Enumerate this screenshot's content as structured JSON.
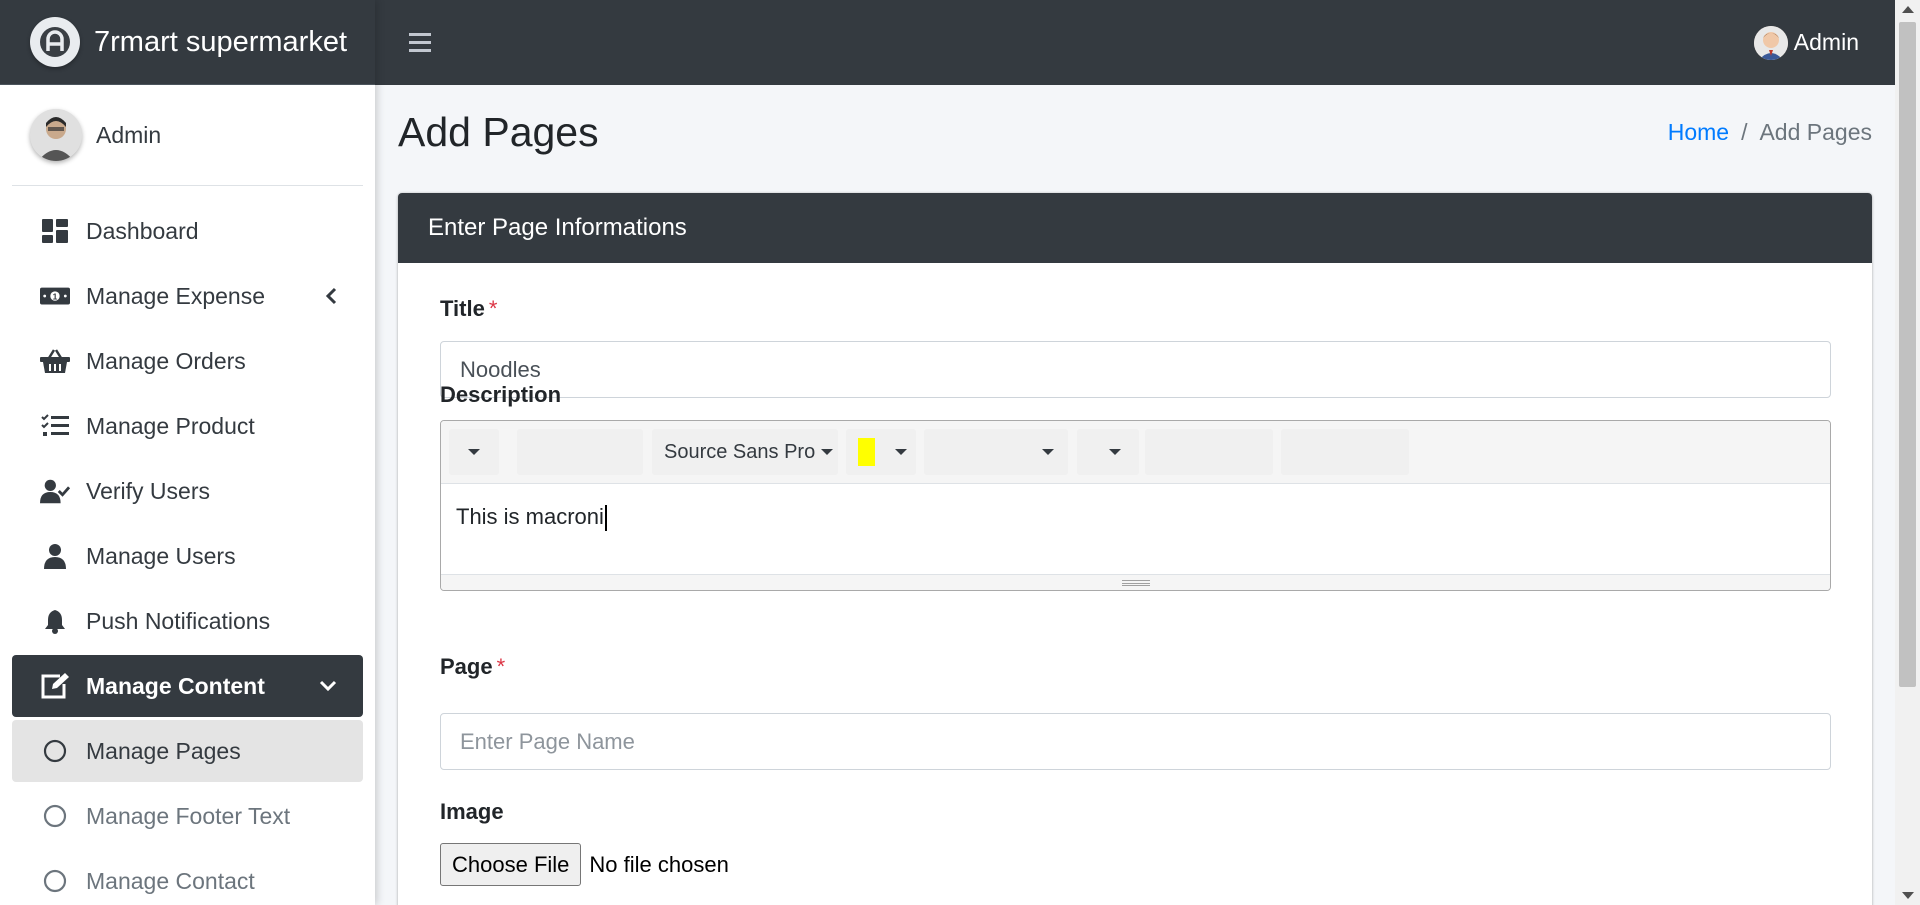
{
  "brand": {
    "name": "7rmart supermarket"
  },
  "sidebar": {
    "user_name": "Admin",
    "items": [
      {
        "label": "Dashboard",
        "icon": "dashboard-icon"
      },
      {
        "label": "Manage Expense",
        "icon": "money-icon"
      },
      {
        "label": "Manage Orders",
        "icon": "basket-icon"
      },
      {
        "label": "Manage Product",
        "icon": "tasks-icon"
      },
      {
        "label": "Verify Users",
        "icon": "user-check-icon"
      },
      {
        "label": "Manage Users",
        "icon": "user-icon"
      },
      {
        "label": "Push Notifications",
        "icon": "bell-icon"
      },
      {
        "label": "Manage Content",
        "icon": "edit-icon"
      },
      {
        "label": "Manage Pages",
        "icon": "circle-icon"
      },
      {
        "label": "Manage Footer Text",
        "icon": "circle-icon"
      },
      {
        "label": "Manage Contact",
        "icon": "circle-icon"
      }
    ]
  },
  "topbar": {
    "user_name": "Admin"
  },
  "page": {
    "title": "Add Pages",
    "breadcrumb": {
      "home": "Home",
      "separator": "/",
      "current": "Add Pages"
    }
  },
  "form": {
    "header": "Enter Page Informations",
    "title_label": "Title",
    "title_value": "Noodles",
    "required_mark": "*",
    "description_label": "Description",
    "editor": {
      "font_name": "Source Sans Pro",
      "highlight_color": "#ffff00",
      "content": "This is macroni"
    },
    "page_label": "Page",
    "page_placeholder": "Enter Page Name",
    "image_label": "Image",
    "file_button": "Choose File",
    "file_status": "No file chosen"
  },
  "colors": {
    "dark": "#343a40",
    "accent_link": "#007bff",
    "required": "#dc3545"
  }
}
